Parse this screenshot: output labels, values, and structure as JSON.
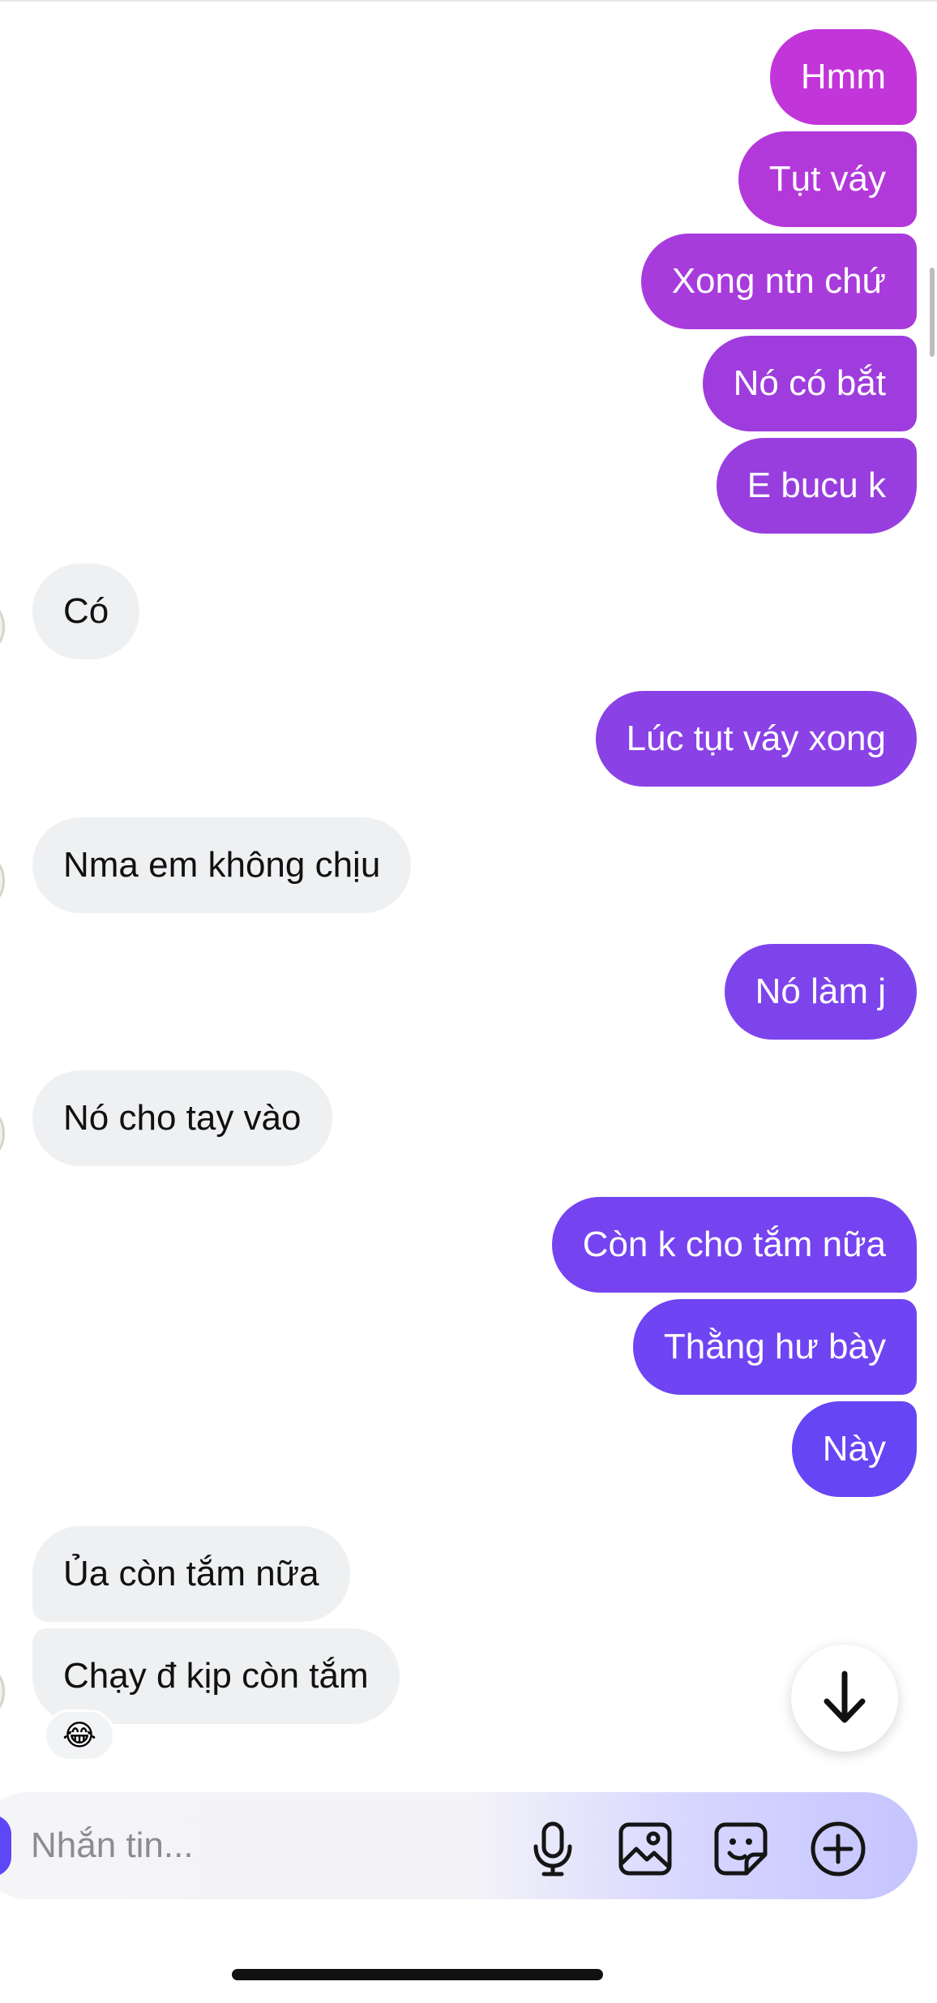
{
  "conversation": {
    "messages": [
      {
        "side": "out",
        "text": "Hmm",
        "color": "#c235d9"
      },
      {
        "side": "out",
        "text": "Tụt váy",
        "color": "#b338da"
      },
      {
        "side": "out",
        "text": "Xong ntn chứ",
        "color": "#a83bdc"
      },
      {
        "side": "out",
        "text": "Nó có bắt",
        "color": "#9f3cdd"
      },
      {
        "side": "out",
        "text": "E bucu k",
        "color": "#983ede"
      },
      {
        "side": "in",
        "text": "Có"
      },
      {
        "side": "out",
        "text": "Lúc tụt váy xong",
        "color": "#8a41e6"
      },
      {
        "side": "in",
        "text": "Nma em không chịu"
      },
      {
        "side": "out",
        "text": "Nó làm j",
        "color": "#7e44ec"
      },
      {
        "side": "in",
        "text": "Nó cho tay vào"
      },
      {
        "side": "out",
        "text": "Còn k cho tắm nữa",
        "color": "#7544f0"
      },
      {
        "side": "out",
        "text": "Thằng hư bày",
        "color": "#6f44f2"
      },
      {
        "side": "out",
        "text": "Này",
        "color": "#6545f4"
      },
      {
        "side": "in",
        "text": "Ủa còn tắm nữa"
      },
      {
        "side": "in",
        "text": "Chạy đ kịp còn tắm",
        "reaction": "😂"
      }
    ]
  },
  "composer": {
    "placeholder": "Nhắn tin...",
    "accent_color": "#5e47f7",
    "icons": [
      "microphone-icon",
      "image-icon",
      "sticker-icon",
      "plus-circle-icon"
    ]
  },
  "scroll_down_icon": "arrow-down-icon"
}
